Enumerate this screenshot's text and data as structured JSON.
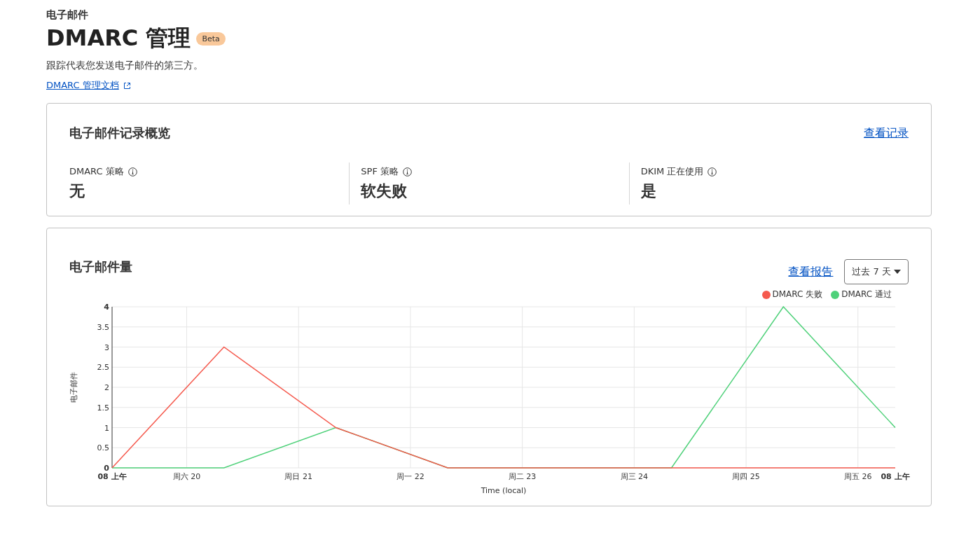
{
  "header": {
    "breadcrumb": "电子邮件",
    "title": "DMARC 管理",
    "badge": "Beta",
    "description": "跟踪代表您发送电子邮件的第三方。",
    "docs_link": "DMARC 管理文档"
  },
  "overview": {
    "title": "电子邮件记录概览",
    "action": "查看记录",
    "stats": [
      {
        "label": "DMARC 策略",
        "value": "无"
      },
      {
        "label": "SPF 策略",
        "value": "软失败"
      },
      {
        "label": "DKIM 正在使用",
        "value": "是"
      }
    ]
  },
  "volume": {
    "title": "电子邮件量",
    "action": "查看报告",
    "range": "过去 7 天",
    "day_labels": [
      "周六 20",
      "周日 21",
      "周一 22",
      "周二 23",
      "周三 24",
      "周四 25",
      "周五 26"
    ],
    "chart_data": {
      "type": "line",
      "xlabel": "Time (local)",
      "ylabel": "电子邮件",
      "categories": [
        "08 上午",
        null,
        null,
        null,
        null,
        null,
        null,
        "08 上午"
      ],
      "series": [
        {
          "name": "DMARC 失败",
          "color": "#f55a4e",
          "values": [
            0,
            3,
            1,
            0,
            0,
            0,
            0,
            0
          ]
        },
        {
          "name": "DMARC 通过",
          "color": "#4fd17a",
          "values": [
            0,
            0,
            1,
            0,
            0,
            0,
            4,
            1
          ]
        }
      ],
      "ylim": [
        0,
        4
      ],
      "grid": true,
      "yticks": [
        0,
        0.5,
        1,
        1.5,
        2,
        2.5,
        3,
        3.5,
        4
      ]
    }
  }
}
